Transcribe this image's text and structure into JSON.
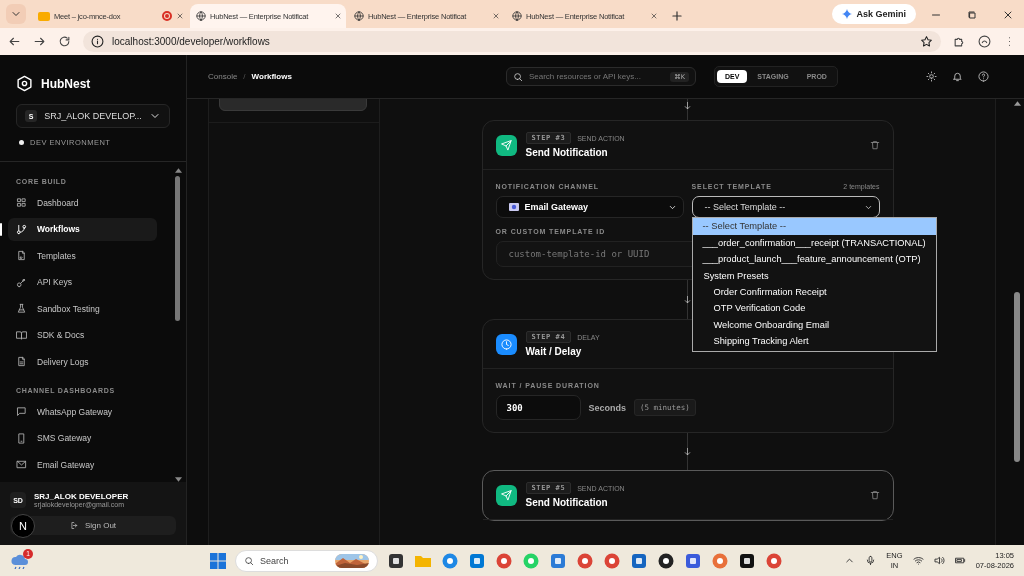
{
  "browser": {
    "tabs": [
      {
        "title": "Meet – jco-mnce-dox",
        "kind": "meet",
        "selected": false
      },
      {
        "title": "HubNest — Enterprise Notificat",
        "kind": "page",
        "selected": true
      },
      {
        "title": "HubNest — Enterprise Notificat",
        "kind": "page",
        "selected": false
      },
      {
        "title": "HubNest — Enterprise Notificat",
        "kind": "page",
        "selected": false
      }
    ],
    "gemini": "Ask Gemini",
    "url": "localhost:3000/developer/workflows"
  },
  "sidebar": {
    "brand": "HubNest",
    "workspace": {
      "initial": "S",
      "name": "SRJ_ALOK DEVELOP..."
    },
    "environment": "DEV ENVIRONMENT",
    "sections": [
      {
        "title": "CORE BUILD",
        "items": [
          {
            "label": "Dashboard",
            "selected": false
          },
          {
            "label": "Workflows",
            "selected": true
          },
          {
            "label": "Templates",
            "selected": false
          },
          {
            "label": "API Keys",
            "selected": false
          },
          {
            "label": "Sandbox Testing",
            "selected": false
          },
          {
            "label": "SDK & Docs",
            "selected": false
          },
          {
            "label": "Delivery Logs",
            "selected": false
          }
        ]
      },
      {
        "title": "CHANNEL DASHBOARDS",
        "items": [
          {
            "label": "WhatsApp Gateway",
            "selected": false
          },
          {
            "label": "SMS Gateway",
            "selected": false
          },
          {
            "label": "Email Gateway",
            "selected": false
          }
        ]
      }
    ],
    "user": {
      "initials": "SD",
      "name": "SRJ_ALOK DEVELOPER",
      "email": "srjalokdeveloper@gmail.com"
    },
    "sign_out": "Sign Out",
    "dev_badge": "N"
  },
  "header": {
    "breadcrumbs": [
      "Console",
      "Workflows"
    ],
    "separator": "/",
    "search": {
      "placeholder": "Search resources or API keys...",
      "shortcut": "⌘K"
    },
    "environments": [
      {
        "label": "DEV",
        "selected": true
      },
      {
        "label": "STAGING",
        "selected": false
      },
      {
        "label": "PROD",
        "selected": false
      }
    ]
  },
  "workflow": {
    "steps": [
      {
        "kind": "send",
        "number": "STEP #3",
        "type": "SEND ACTION",
        "title": "Send Notification",
        "selected": false,
        "deletable": true,
        "channel": {
          "label": "NOTIFICATION CHANNEL",
          "value": "Email Gateway"
        },
        "template": {
          "label": "SELECT TEMPLATE",
          "count": "2 templates",
          "value": "-- Select Template --",
          "expanded": true,
          "options": [
            {
              "label": "-- Select Template --",
              "selected": true
            },
            {
              "label": "___order_confirmation___receipt (TRANSACTIONAL)",
              "selected": false
            },
            {
              "label": "___product_launch___feature_announcement (OTP)",
              "selected": false
            },
            {
              "label": "System Presets",
              "kind": "group",
              "children": [
                {
                  "label": "Order Confirmation Receipt",
                  "selected": false
                },
                {
                  "label": "OTP Verification Code",
                  "selected": false
                },
                {
                  "label": "Welcome Onboarding Email",
                  "selected": false
                },
                {
                  "label": "Shipping Tracking Alert",
                  "selected": false
                }
              ]
            }
          ]
        },
        "custom_id": {
          "label": "OR CUSTOM TEMPLATE ID",
          "placeholder": "custom-template-id or UUID"
        }
      },
      {
        "kind": "delay",
        "number": "STEP #4",
        "type": "DELAY",
        "title": "Wait / Delay",
        "selected": false,
        "deletable": false,
        "duration": {
          "label": "WAIT / PAUSE DURATION",
          "value": "300",
          "unit": "Seconds",
          "hint": "(5 minutes)"
        }
      },
      {
        "kind": "send",
        "number": "STEP #5",
        "type": "SEND ACTION",
        "title": "Send Notification",
        "selected": true,
        "deletable": true
      }
    ]
  },
  "taskbar": {
    "weather_badge": "1",
    "search": "Search",
    "language": "ENG",
    "region": "IN",
    "time": "13:05",
    "date": "07-08-2026"
  }
}
